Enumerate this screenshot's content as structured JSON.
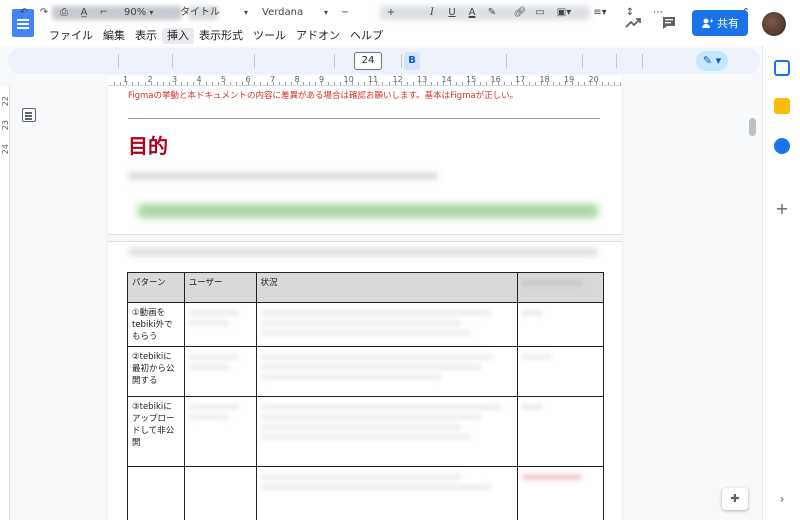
{
  "header": {
    "menu": [
      "ファイル",
      "編集",
      "表示",
      "挿入",
      "表示形式",
      "ツール",
      "アドオン",
      "ヘルプ"
    ],
    "active_menu": "挿入",
    "share_label": "共有",
    "icons": [
      "trending-icon",
      "comment-icon",
      "share-person-icon"
    ]
  },
  "toolbar": {
    "zoom": "90%",
    "style": "タイトル",
    "font": "Verdana",
    "font_size": "24",
    "minus": "−",
    "plus": "+",
    "bold": "B",
    "italic": "I",
    "underline": "U",
    "text_color": "A",
    "more": "⋯",
    "accent_color": "#1a73e8"
  },
  "ruler": {
    "marks": [
      "1",
      "2",
      "3",
      "4",
      "5",
      "6",
      "7",
      "8",
      "9",
      "10",
      "11",
      "12",
      "13",
      "14",
      "15",
      "16",
      "17",
      "18",
      "19",
      "20"
    ]
  },
  "vruler": [
    "22",
    "23",
    "24"
  ],
  "document": {
    "notice": "Figmaの挙動と本ドキュメントの内容に差異がある場合は確認お願いします。基本はFigmaが正しい。",
    "heading": "目的",
    "heading_color": "#b00020",
    "notice_color": "#d93025"
  },
  "table": {
    "headers": [
      "パターン",
      "ユーザー",
      "状況",
      ""
    ],
    "rows": [
      {
        "pattern": "①動画をtebiki外でもらう"
      },
      {
        "pattern": "②tebikiに最初から公開する"
      },
      {
        "pattern": "③tebikiにアップロードして非公開"
      },
      {
        "pattern": ""
      }
    ]
  }
}
